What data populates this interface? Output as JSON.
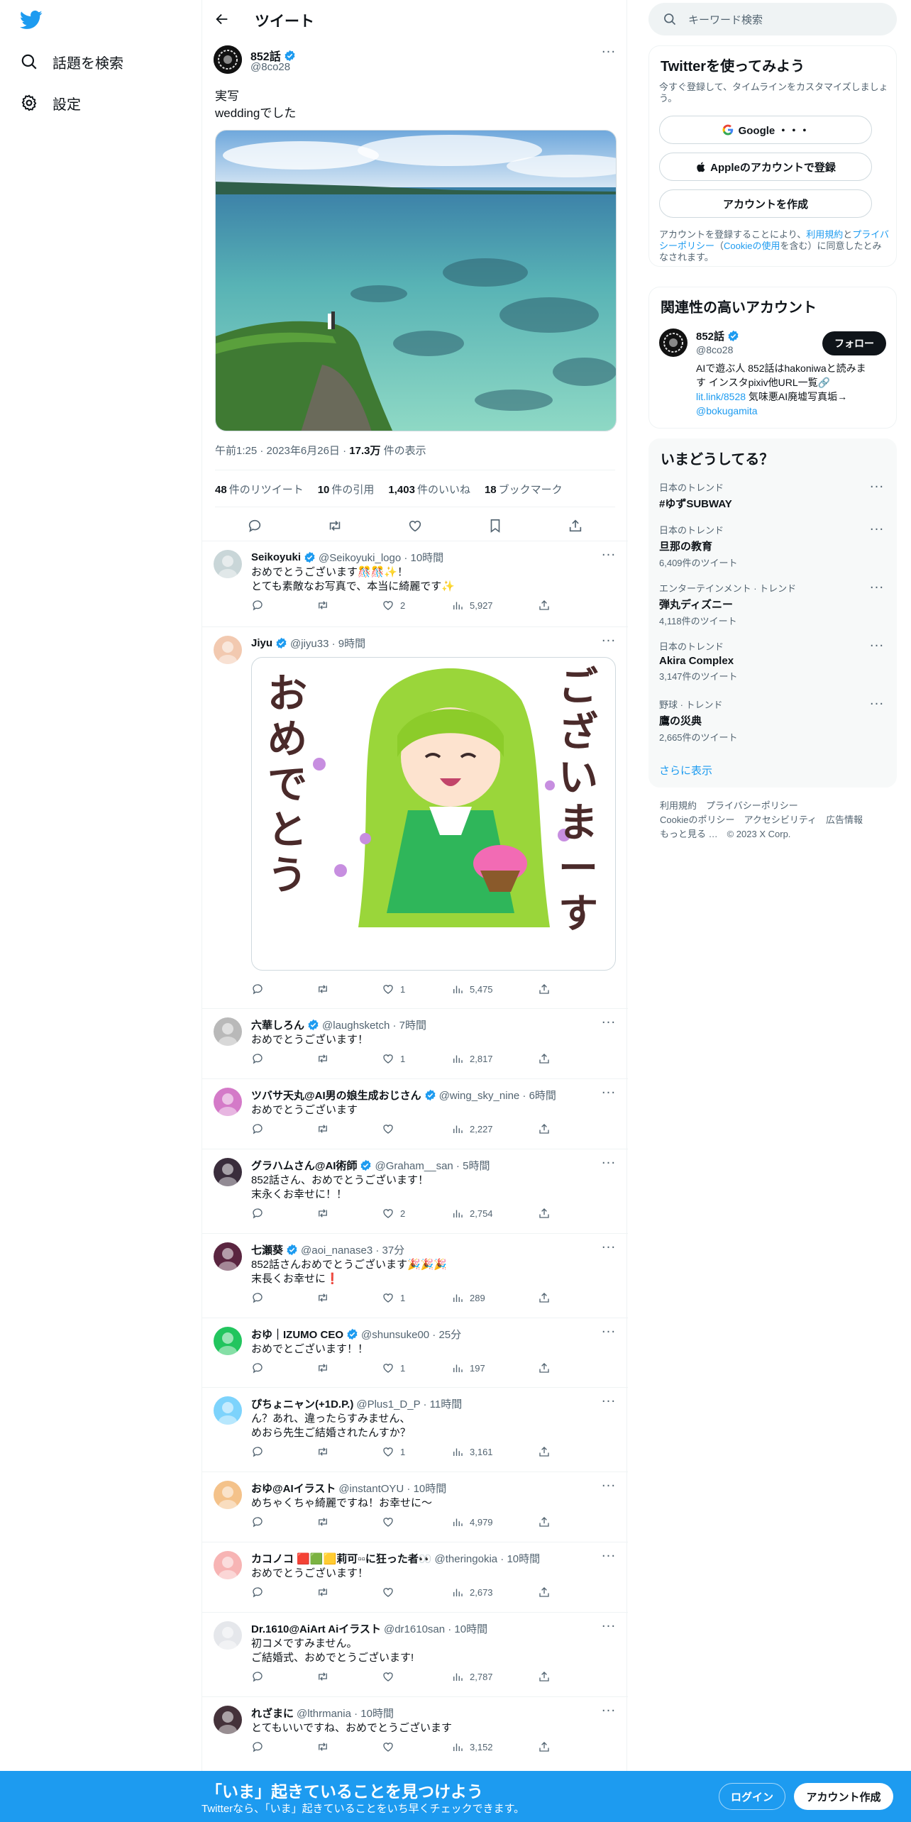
{
  "nav": {
    "explore_label": "話題を検索",
    "settings_label": "設定"
  },
  "topbar": {
    "title": "ツイート"
  },
  "main_tweet": {
    "author_name": "852話",
    "author_handle": "@8co28",
    "text_line1": "実写",
    "text_line2": "weddingでした",
    "time": "午前1:25 · 2023年6月26日 · ",
    "views": "17.3万",
    "views_label": " 件の表示",
    "retweets": "48",
    "retweets_label": "件のリツイート",
    "quotes": "10",
    "quotes_label": "件の引用",
    "likes": "1,403",
    "likes_label": "件のいいね",
    "bookmarks": "18",
    "bookmarks_label": "ブックマーク"
  },
  "replies": [
    {
      "name": "Seikoyuki",
      "handle": "@Seikoyuki_logo · 10時間",
      "line1": "おめでとうございます🎊🎊✨！",
      "line2": "とても素敵なお写真で、本当に綺麗です✨",
      "likes": "2",
      "views": "5,927"
    },
    {
      "name": "Jiyu",
      "handle": "@jiyu33 · 9時間",
      "line1": "",
      "line2": "",
      "likes": "1",
      "views": "5,475",
      "sticker_text1": "おめでとう",
      "sticker_text2": "ございまーす"
    },
    {
      "name": "六華しろん",
      "handle": "@laughsketch · 7時間",
      "line1": "おめでとうございます！",
      "line2": "",
      "likes": "1",
      "views": "2,817"
    },
    {
      "name": "ツバサ天丸@AI男の娘生成おじさん",
      "handle": "@wing_sky_nine · 6時間",
      "line1": "おめでとうございます",
      "line2": "",
      "likes": "",
      "views": "2,227"
    },
    {
      "name": "グラハムさん@AI術師",
      "handle": "@Graham__san · 5時間",
      "line1": "852話さん、おめでとうございます！",
      "line2": "末永くお幸せに！！",
      "likes": "2",
      "views": "2,754"
    },
    {
      "name": "七瀬葵",
      "handle": "@aoi_nanase3 · 37分",
      "line1": "852話さんおめでとうございます🎉🎉🎉",
      "line2": "末長くお幸せに❗",
      "likes": "1",
      "views": "289"
    },
    {
      "name": "おゆ｜IZUMO CEO",
      "handle": "@shunsuke00 · 25分",
      "line1": "おめでとございます！！",
      "line2": "",
      "likes": "1",
      "views": "197"
    },
    {
      "name": "ぴちょニャン(+1D.P.)",
      "handle": "@Plus1_D_P · 11時間",
      "line1": "ん？あれ、違ったらすみません、",
      "line2": "めおら先生ご結婚されたんすか？",
      "likes": "1",
      "views": "3,161"
    },
    {
      "name": "おゆ@AIイラスト",
      "handle": "@instantOYU · 10時間",
      "line1": "めちゃくちゃ綺麗ですね！お幸せに〜",
      "line2": "",
      "likes": "",
      "views": "4,979"
    },
    {
      "name": "カコノコ 🟥🟩🟨莉可▫▫に狂った者👀",
      "handle": "@theringokia · 10時間",
      "line1": "おめでとうございます！",
      "line2": "",
      "likes": "",
      "views": "2,673"
    },
    {
      "name": "Dr.1610@AiArt Aiイラスト",
      "handle": "@dr1610san · 10時間",
      "line1": "初コメですみません。",
      "line2": "ご結婚式、おめでとうございます!",
      "likes": "",
      "views": "2,787"
    },
    {
      "name": "れざまに",
      "handle": "@lthrmania · 10時間",
      "line1": "とてもいいですね、おめでとうございます",
      "line2": "",
      "likes": "",
      "views": "3,152"
    }
  ],
  "right": {
    "search_placeholder": "キーワード検索",
    "signup_title": "Twitterを使ってみよう",
    "signup_sub": "今すぐ登録して、タイムラインをカスタマイズしましょう。",
    "google_label": "Google ・・・",
    "apple_label": "Appleのアカウントで登録",
    "create_label": "アカウントを作成",
    "terms_1": "アカウントを登録することにより、",
    "terms_link1": "利用規約",
    "terms_2": "と",
    "terms_link2": "プライバシーポリシー",
    "terms_3": "（",
    "terms_link3": "Cookieの使用",
    "terms_4": "を含む）に同意したとみなされます。",
    "related_title": "関連性の高いアカウント",
    "related_name": "852話",
    "related_handle": "@8co28",
    "follow_label": "フォロー",
    "related_bio1": "AIで遊ぶ人 852話はhakoniwaと読みま",
    "related_bio2": "す インスタpixiv他URL一覧🔗",
    "related_bio_link": "lit.link/8528",
    "related_bio3": " 気味悪AI廃墟写真垢→",
    "related_bio_link2": "@bokugamita",
    "trends_title": "いまどうしてる？",
    "trends": [
      {
        "cat": "日本のトレンド",
        "title": "#ゆずSUBWAY",
        "count": ""
      },
      {
        "cat": "日本のトレンド",
        "title": "旦那の教育",
        "count": "6,409件のツイート"
      },
      {
        "cat": "エンターテインメント · トレンド",
        "title": "弾丸ディズニー",
        "count": "4,118件のツイート"
      },
      {
        "cat": "日本のトレンド",
        "title": "Akira Complex",
        "count": "3,147件のツイート"
      },
      {
        "cat": "野球 · トレンド",
        "title": "鷹の災典",
        "count": "2,665件のツイート"
      }
    ],
    "show_more": "さらに表示",
    "footer1": "利用規約　プライバシーポリシー",
    "footer2": "Cookieのポリシー　アクセシビリティ　広告情報",
    "footer3": "もっと見る …　© 2023 X Corp."
  },
  "bottom": {
    "title": "「いま」起きていることを見つけよう",
    "sub": "Twitterなら、「いま」起きていることをいち早くチェックできます。",
    "login": "ログイン",
    "signup": "アカウント作成"
  },
  "colors": {
    "accent": "#1d9bf0",
    "text": "#0f1419",
    "muted": "#536471"
  }
}
